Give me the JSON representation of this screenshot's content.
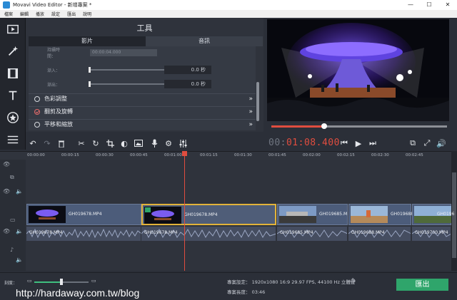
{
  "window": {
    "title": "Movavi Video Editor - 新增專案 *",
    "controls": [
      "—",
      "☐",
      "✕"
    ]
  },
  "menu": [
    "檔案",
    "編輯",
    "播放",
    "設定",
    "匯出",
    "說明"
  ],
  "toolstrip": {
    "items": [
      "import-video-icon",
      "magic-wand-icon",
      "filters-icon",
      "titles-icon",
      "stickers-icon",
      "list-icon"
    ]
  },
  "tools_panel": {
    "heading": "工具",
    "tabs": [
      {
        "label": "影片",
        "active": true
      },
      {
        "label": "音訊",
        "active": false
      }
    ],
    "rows": [
      {
        "label": "持續時間：",
        "value": "00:00:04.000"
      },
      {
        "label": "漸入：",
        "value": "0.0 秒"
      },
      {
        "label": "漸出：",
        "value": "0.0 秒"
      }
    ],
    "sections": [
      {
        "label": "色彩調整",
        "checked": false
      },
      {
        "label": "翻剪及旋轉",
        "checked": true
      },
      {
        "label": "平移和縮放",
        "checked": false
      }
    ]
  },
  "player": {
    "timecode_dim": "00:",
    "timecode_active": "01:08.400",
    "progress": 0.3
  },
  "ruler": [
    "00:00:00",
    "00:00:15",
    "00:00:30",
    "00:00:45",
    "00:01:00",
    "00:01:15",
    "00:01:30",
    "00:01:45",
    "00:02:00",
    "00:02:15",
    "00:02:30",
    "00:02:45"
  ],
  "clips": [
    {
      "name": "GH019678.MP4"
    },
    {
      "name": "GH019678.MP4",
      "selected": true
    },
    {
      "name": "GH019685.M"
    },
    {
      "name": "GH019688.MP4"
    },
    {
      "name": "GH0196"
    }
  ],
  "audio_clips": [
    {
      "name": "GH019678.MP4"
    },
    {
      "name": "GH019678.MP4"
    },
    {
      "name": "GH019685.MP4"
    },
    {
      "name": "GH019688.MP4"
    },
    {
      "name": "GH019700.MP4"
    }
  ],
  "bottom": {
    "scale_label": "刻度：",
    "zoom": 0.5,
    "project_settings": "專案設定：  1920x1080 16:9 29.97 FPS, 44100 Hz 立體聲",
    "project_length": "專案長度：  03:46",
    "export_label": "匯出",
    "watermark": "http://hardaway.com.tw/blog"
  }
}
